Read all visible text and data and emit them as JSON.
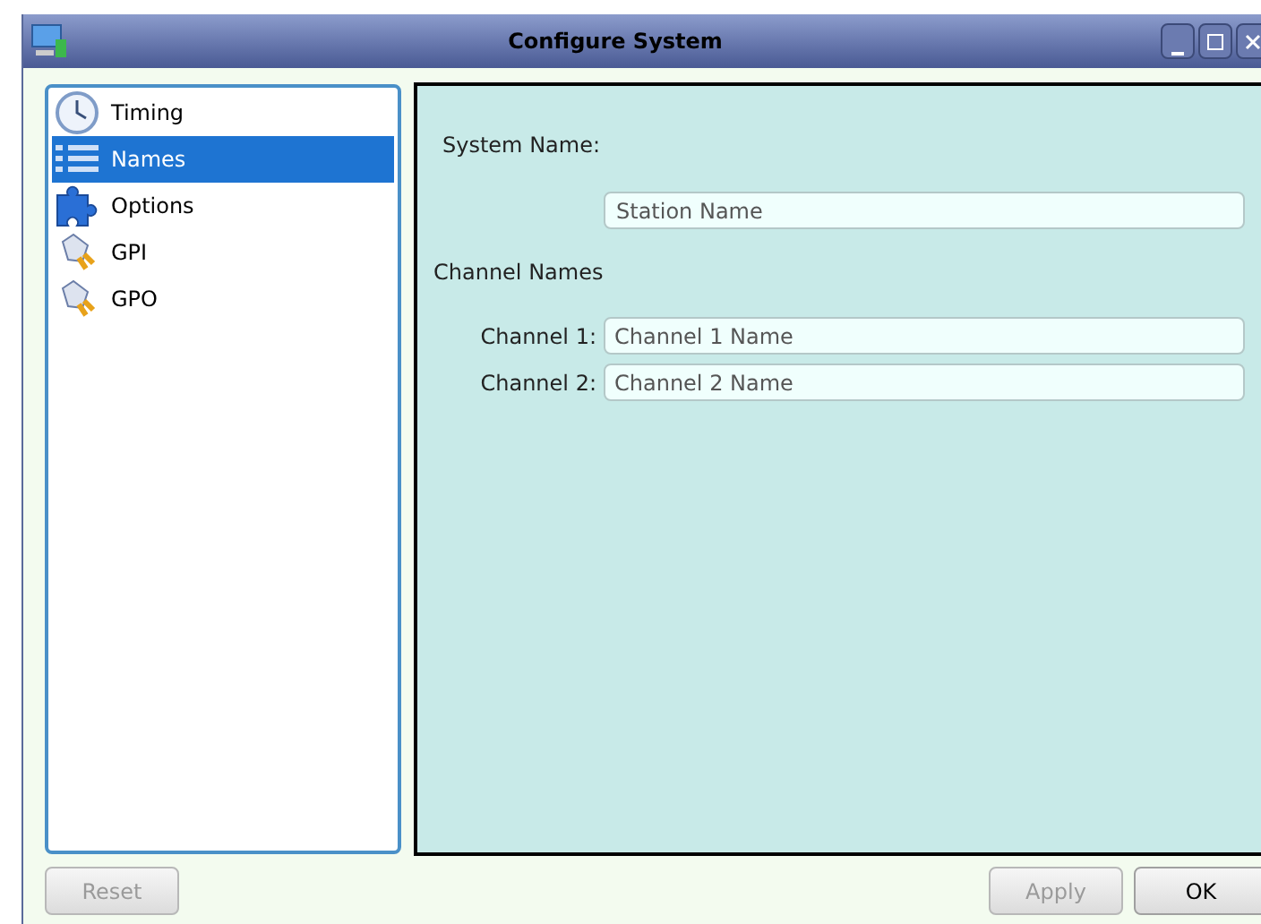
{
  "window": {
    "title": "Configure System"
  },
  "sidebar": {
    "items": [
      {
        "label": "Timing",
        "kind": "clock",
        "selected": false
      },
      {
        "label": "Names",
        "kind": "list",
        "selected": true
      },
      {
        "label": "Options",
        "kind": "puzzle",
        "selected": false
      },
      {
        "label": "GPI",
        "kind": "plug",
        "selected": false
      },
      {
        "label": "GPO",
        "kind": "plug",
        "selected": false
      }
    ]
  },
  "system": {
    "label": "System Name:",
    "field": {
      "placeholder": "Station Name"
    }
  },
  "channels": {
    "heading": "Channel Names",
    "rows": [
      {
        "label": "Channel 1:",
        "placeholder": "Channel 1 Name"
      },
      {
        "label": "Channel 2:",
        "placeholder": "Channel 2 Name"
      }
    ]
  },
  "left_buttons": [
    {
      "label": "Reset",
      "disabled": true
    }
  ],
  "right_buttons": [
    {
      "label": "Apply",
      "disabled": true
    },
    {
      "label": "OK",
      "disabled": false
    }
  ]
}
